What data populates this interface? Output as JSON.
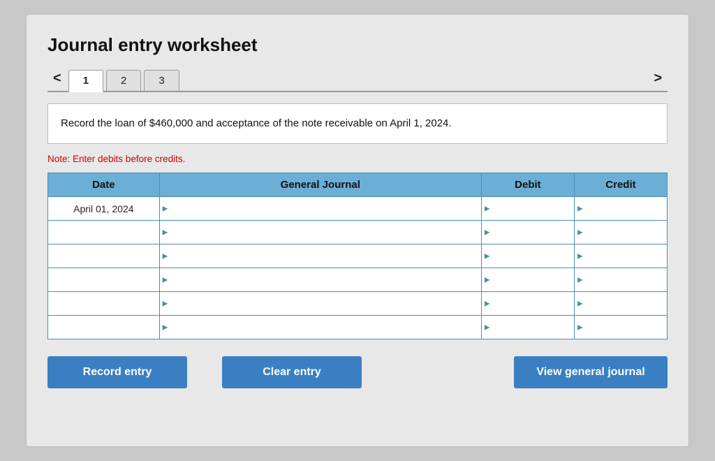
{
  "title": "Journal entry worksheet",
  "navigation": {
    "prev_label": "<",
    "next_label": ">",
    "tabs": [
      {
        "id": 1,
        "label": "1",
        "active": true
      },
      {
        "id": 2,
        "label": "2",
        "active": false
      },
      {
        "id": 3,
        "label": "3",
        "active": false
      }
    ]
  },
  "description": "Record the loan of $460,000 and acceptance of the note receivable on April 1, 2024.",
  "note": "Note: Enter debits before credits.",
  "table": {
    "headers": [
      "Date",
      "General Journal",
      "Debit",
      "Credit"
    ],
    "rows": [
      {
        "date": "April 01, 2024",
        "gj": "",
        "debit": "",
        "credit": ""
      },
      {
        "date": "",
        "gj": "",
        "debit": "",
        "credit": ""
      },
      {
        "date": "",
        "gj": "",
        "debit": "",
        "credit": ""
      },
      {
        "date": "",
        "gj": "",
        "debit": "",
        "credit": ""
      },
      {
        "date": "",
        "gj": "",
        "debit": "",
        "credit": ""
      },
      {
        "date": "",
        "gj": "",
        "debit": "",
        "credit": ""
      }
    ]
  },
  "buttons": {
    "record_entry": "Record entry",
    "clear_entry": "Clear entry",
    "view_general_journal": "View general journal"
  },
  "colors": {
    "header_bg": "#6baed6",
    "button_bg": "#3a7fc1",
    "note_color": "#cc0000"
  }
}
